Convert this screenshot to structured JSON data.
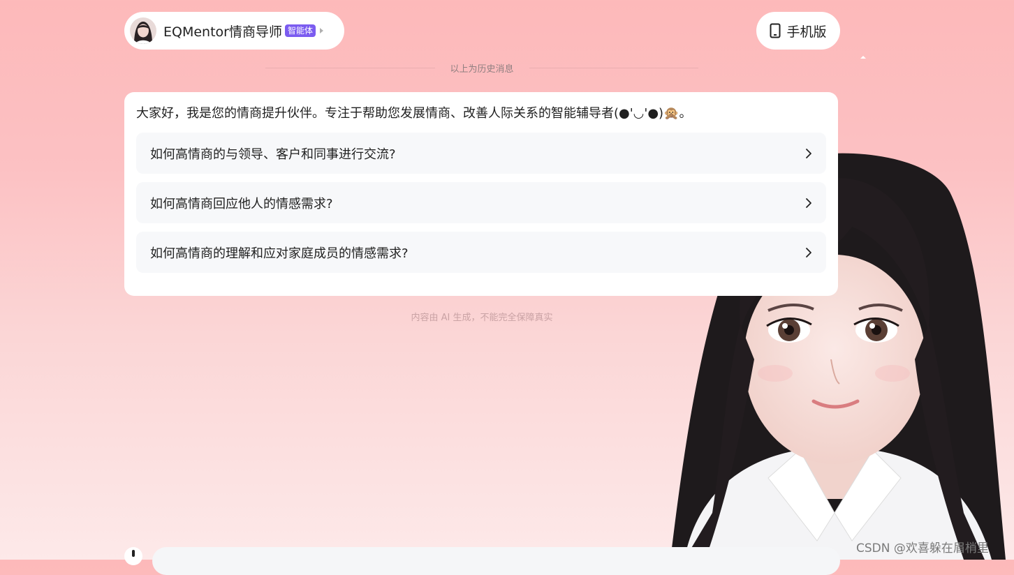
{
  "header": {
    "agent_name": "EQMentor情商导师",
    "agent_badge": "智能体",
    "mobile_label": "手机版"
  },
  "history_divider": "以上为历史消息",
  "chat": {
    "greeting": "大家好，我是您的情商提升伙伴。专注于帮助您发展情商、改善人际关系的智能辅导者(●'◡'●)🙊。",
    "suggestions": [
      "如何高情商的与领导、客户和同事进行交流?",
      "如何高情商回应他人的情感需求?",
      "如何高情商的理解和应对家庭成员的情感需求?"
    ]
  },
  "disclaimer": "内容由 AI 生成，不能完全保障真实",
  "watermark": "CSDN @欢喜躲在眉梢里",
  "colors": {
    "badge": "#7b5cf0",
    "background_top": "#fdb9ba",
    "card": "#ffffff"
  }
}
